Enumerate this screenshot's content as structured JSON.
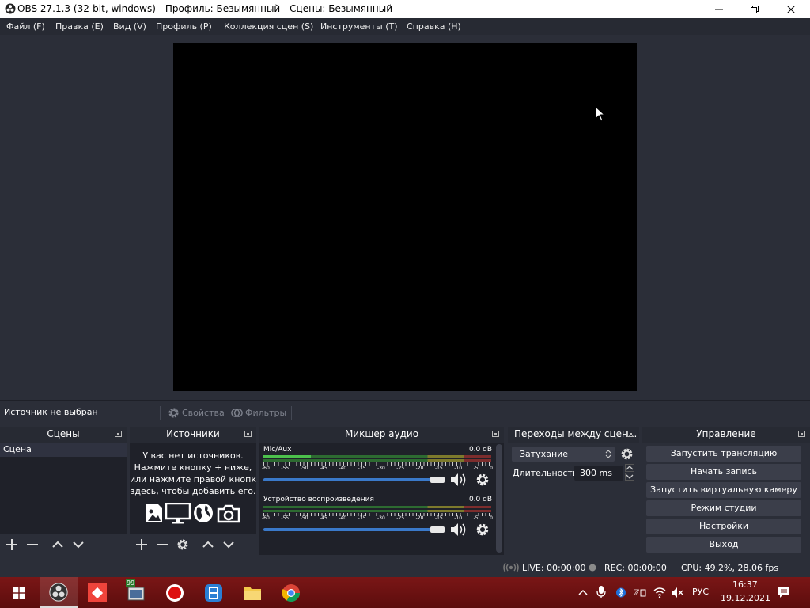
{
  "window": {
    "title": "OBS 27.1.3 (32-bit, windows) - Профиль: Безымянный - Сцены: Безымянный"
  },
  "menu": [
    {
      "label": "Файл (F)"
    },
    {
      "label": "Правка (E)"
    },
    {
      "label": "Вид (V)"
    },
    {
      "label": "Профиль (P)"
    },
    {
      "label": "Коллекция сцен (S)"
    },
    {
      "label": "Инструменты (T)"
    },
    {
      "label": "Справка (H)"
    }
  ],
  "source_bar": {
    "status": "Источник не выбран",
    "properties": "Свойства",
    "filters": "Фильтры"
  },
  "scenes": {
    "title": "Сцены",
    "items": [
      "Сцена"
    ]
  },
  "sources": {
    "title": "Источники",
    "empty_lines": [
      "У вас нет источников.",
      "Нажмите кнопку + ниже,",
      "или нажмите правой кнопкой",
      "здесь, чтобы добавить его."
    ]
  },
  "mixer": {
    "title": "Микшер аудио",
    "tick_labels": [
      "-60",
      "-55",
      "-50",
      "-45",
      "-40",
      "-35",
      "-30",
      "-25",
      "-20",
      "-15",
      "-10",
      "-5",
      "0"
    ],
    "channels": [
      {
        "name": "Mic/Aux",
        "db": "0.0 dB",
        "volume": 1.0
      },
      {
        "name": "Устройство воспроизведения",
        "db": "0.0 dB",
        "volume": 1.0
      }
    ]
  },
  "transitions": {
    "title": "Переходы между сцен...",
    "selected": "Затухание",
    "duration_label": "Длительность",
    "duration_value": "300 ms"
  },
  "controls": {
    "title": "Управление",
    "buttons": [
      "Запустить трансляцию",
      "Начать запись",
      "Запустить виртуальную камеру",
      "Режим студии",
      "Настройки",
      "Выход"
    ]
  },
  "status": {
    "live": "LIVE: 00:00:00",
    "rec": "REC: 00:00:00",
    "cpu": "CPU: 49.2%, 28.06 fps"
  },
  "taskbar": {
    "lang": "РУС",
    "time": "16:37",
    "date": "19.12.2021",
    "badge": "99"
  },
  "colors": {
    "accent": "#3a79c9",
    "panel": "#2b2e38",
    "panel_dark": "#1f2129",
    "taskbar": "#6d1111"
  }
}
